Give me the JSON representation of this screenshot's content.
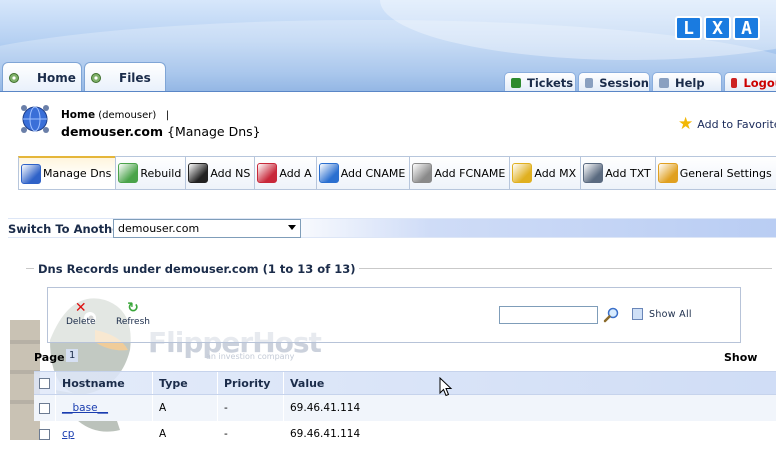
{
  "header": {
    "logo_letters": [
      "L",
      "X",
      "A"
    ],
    "left_tabs": [
      {
        "label": "Home",
        "icon": "home-gear-icon"
      },
      {
        "label": "Files",
        "icon": "files-gear-icon"
      }
    ],
    "right_tabs": [
      {
        "label": "Tickets",
        "icon": "ticket-icon",
        "icon_color": "#2e8b2e"
      },
      {
        "label": "Session",
        "icon": "session-icon",
        "icon_color": "#8aa0c0"
      },
      {
        "label": "Help",
        "icon": "help-icon",
        "icon_color": "#8aa0c0"
      },
      {
        "label": "Logou",
        "icon": "logout-icon",
        "icon_color": "#cc2222",
        "text_color": "#cc0000"
      }
    ]
  },
  "title_block": {
    "crumb_home": "Home",
    "crumb_user": "(demouser)",
    "crumb_sep": "|",
    "domain": "demouser.com",
    "section": "{Manage Dns}",
    "favorites_label": "Add to Favorites"
  },
  "tool_tabs": [
    {
      "label": "Manage Dns",
      "icon": "globe-icon",
      "color": "#2f62c8",
      "active": true
    },
    {
      "label": "Rebuild",
      "icon": "rebuild-icon",
      "color": "#4aa34a"
    },
    {
      "label": "Add NS",
      "icon": "terminal-icon",
      "color": "#222222"
    },
    {
      "label": "Add A",
      "icon": "add-a-icon",
      "color": "#c8283a"
    },
    {
      "label": "Add CNAME",
      "icon": "add-cname-icon",
      "color": "#2a6fd0"
    },
    {
      "label": "Add FCNAME",
      "icon": "add-fcname-icon",
      "color": "#8a8a8a"
    },
    {
      "label": "Add MX",
      "icon": "add-mx-icon",
      "color": "#e0b020"
    },
    {
      "label": "Add TXT",
      "icon": "add-txt-icon",
      "color": "#5a6a80"
    },
    {
      "label": "General Settings",
      "icon": "general-settings-icon",
      "color": "#e0a020"
    }
  ],
  "switch": {
    "label": "Switch To Another",
    "selected": "demouser.com"
  },
  "records": {
    "legend": "Dns Records under demouser.com (1 to 13 of 13)",
    "toolbar": {
      "delete_label": "Delete",
      "refresh_label": "Refresh",
      "search_value": "",
      "show_all_label": "Show All"
    },
    "page_label": "Page",
    "page_number": "1",
    "show_label": "Show",
    "columns": [
      "Hostname",
      "Type",
      "Priority",
      "Value"
    ],
    "rows": [
      {
        "hostname": "__base__",
        "type": "A",
        "priority": "-",
        "value": "69.46.41.114"
      },
      {
        "hostname": "cp",
        "type": "A",
        "priority": "-",
        "value": "69.46.41.114"
      }
    ]
  },
  "watermark": {
    "brand": "FlipperHost",
    "tagline": "an investion company"
  }
}
